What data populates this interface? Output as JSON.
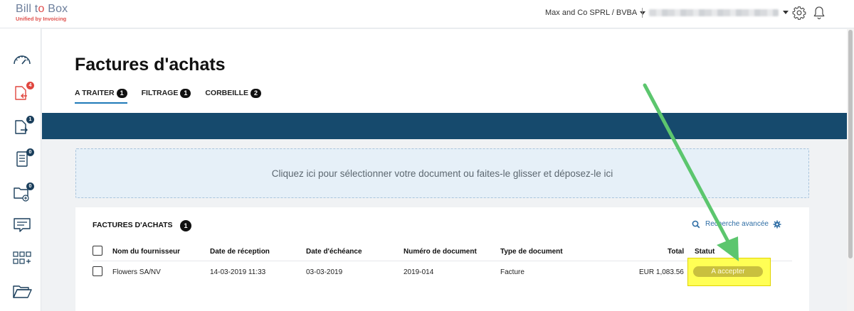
{
  "app": {
    "logo_left": "Bill t",
    "logo_o": "o",
    "logo_right": " Box",
    "logo_sub": "Unified by Invoicing"
  },
  "topbar": {
    "company": "Max and Co SPRL / BVBA",
    "icons": [
      "gear-icon",
      "bell-icon"
    ]
  },
  "sidebar": {
    "items": [
      {
        "icon": "dashboard-gauge-icon"
      },
      {
        "icon": "incoming-documents-icon",
        "badge": "4",
        "badge_color": "#e0463f"
      },
      {
        "icon": "outgoing-documents-icon",
        "badge": "1",
        "badge_color": "#1b3f5c"
      },
      {
        "icon": "document-list-icon",
        "badge": "0",
        "badge_color": "#1b3f5c"
      },
      {
        "icon": "folder-add-icon",
        "badge": "0",
        "badge_color": "#1b3f5c"
      },
      {
        "icon": "message-icon"
      },
      {
        "icon": "apps-grid-icon"
      },
      {
        "icon": "open-folder-icon"
      }
    ]
  },
  "page": {
    "title": "Factures d'achats",
    "tabs": [
      {
        "label": "A TRAITER",
        "count": "1",
        "active": true
      },
      {
        "label": "FILTRAGE",
        "count": "1",
        "active": false
      },
      {
        "label": "CORBEILLE",
        "count": "2",
        "active": false
      }
    ]
  },
  "dropzone": {
    "text": "Cliquez ici pour sélectionner votre document ou faites-le glisser et déposez-le ici"
  },
  "table": {
    "title": "FACTURES D'ACHATS",
    "count": "1",
    "search_link": "Recherche avancée",
    "columns": [
      "Nom du fournisseur",
      "Date de réception",
      "Date d'échéance",
      "Numéro de document",
      "Type de document",
      "Total",
      "Statut"
    ],
    "rows": [
      {
        "supplier": "Flowers SA/NV",
        "received": "14-03-2019 11:33",
        "due": "03-03-2019",
        "number": "2019-014",
        "type": "Facture",
        "total": "EUR 1,083.56",
        "status": "A accepter"
      }
    ]
  },
  "colors": {
    "banner": "#164a6d",
    "accent_tab": "#1f7ab8",
    "status_pill": "#c9c03e",
    "highlight": "#ffff55",
    "annotation_arrow": "#5cc66e"
  }
}
